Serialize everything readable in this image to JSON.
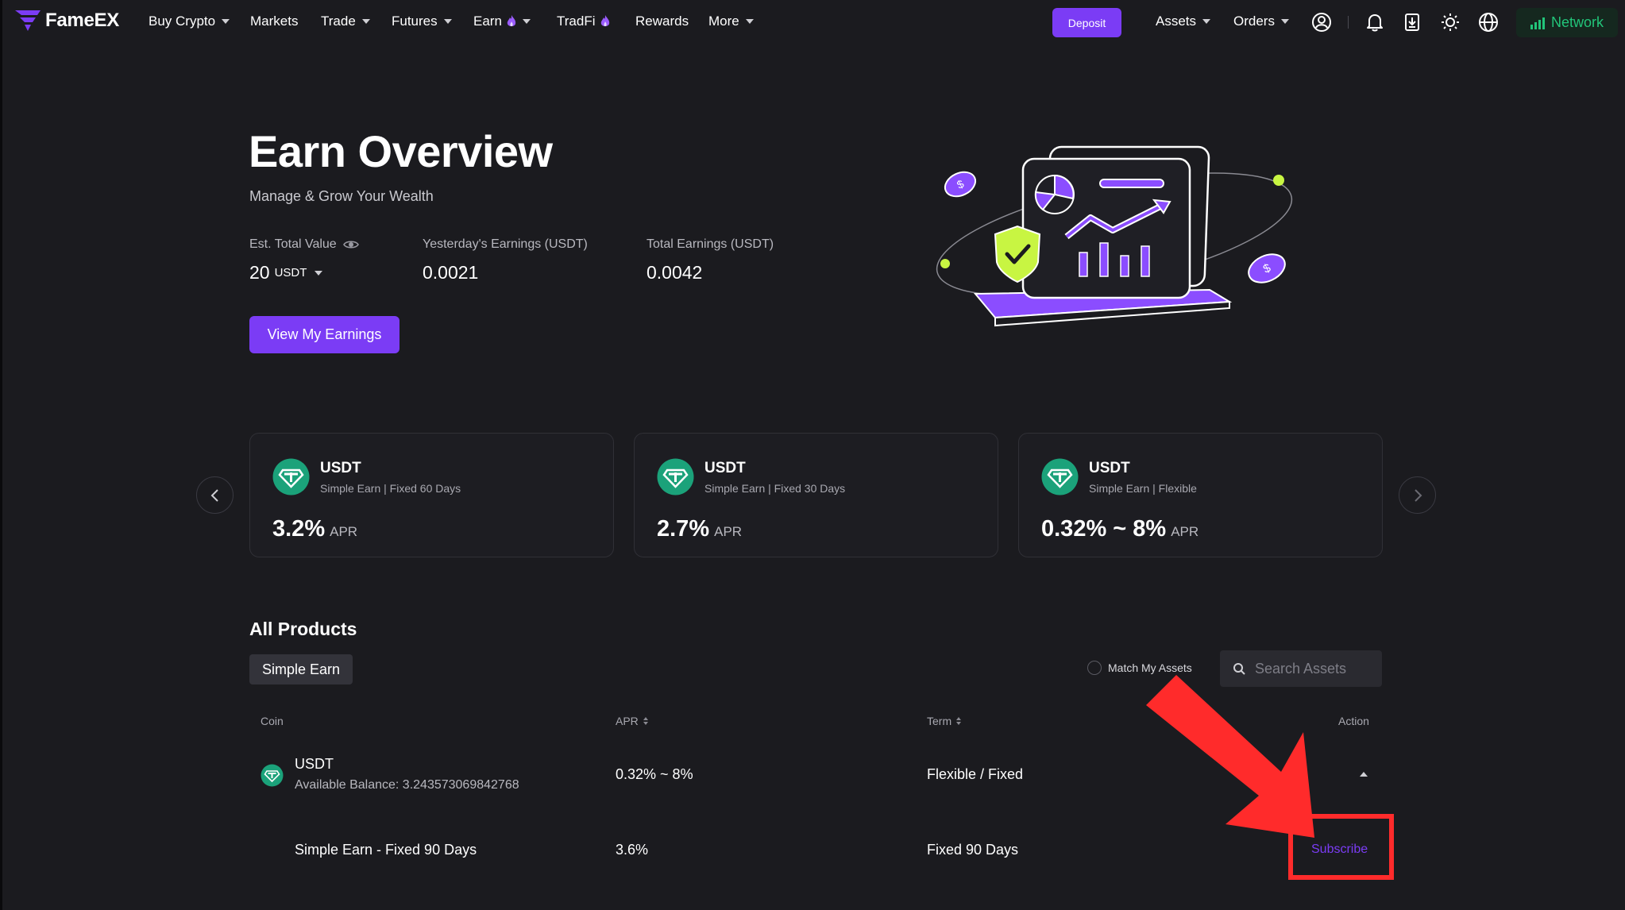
{
  "header": {
    "brand": "FameEX",
    "nav": [
      {
        "label": "Buy Crypto",
        "dropdown": true
      },
      {
        "label": "Markets"
      },
      {
        "label": "Trade",
        "dropdown": true
      },
      {
        "label": "Futures",
        "dropdown": true
      },
      {
        "label": "Earn",
        "dropdown": true,
        "hot": true
      },
      {
        "label": "TradFi",
        "hot": true
      },
      {
        "label": "Rewards"
      },
      {
        "label": "More",
        "dropdown": true
      }
    ],
    "deposit_label": "Deposit",
    "assets_label": "Assets",
    "orders_label": "Orders",
    "icons": [
      "user-icon",
      "bell-icon",
      "download-icon",
      "sun-icon",
      "globe-icon"
    ],
    "network_label": "Network"
  },
  "hero": {
    "title": "Earn Overview",
    "subtitle": "Manage & Grow Your Wealth",
    "est_total_label": "Est. Total Value",
    "est_total_value": "20",
    "est_total_unit": "USDT",
    "yesterday_label": "Yesterday's Earnings (USDT)",
    "yesterday_value": "0.0021",
    "total_label": "Total Earnings (USDT)",
    "total_value": "0.0042",
    "view_button": "View My Earnings"
  },
  "cards": [
    {
      "coin": "USDT",
      "sub": "Simple Earn | Fixed 60 Days",
      "apr": "3.2%",
      "apr_label": "APR"
    },
    {
      "coin": "USDT",
      "sub": "Simple Earn | Fixed 30 Days",
      "apr": "2.7%",
      "apr_label": "APR"
    },
    {
      "coin": "USDT",
      "sub": "Simple Earn | Flexible",
      "apr": "0.32% ~ 8%",
      "apr_label": "APR"
    }
  ],
  "products": {
    "title": "All Products",
    "tab": "Simple Earn",
    "match_label": "Match My Assets",
    "search_placeholder": "Search Assets",
    "columns": {
      "coin": "Coin",
      "apr": "APR",
      "term": "Term",
      "action": "Action"
    },
    "rows": [
      {
        "coin": "USDT",
        "balance": "Available Balance: 3.243573069842768",
        "apr": "0.32% ~ 8%",
        "term": "Flexible / Fixed"
      }
    ],
    "subrows": [
      {
        "name": "Simple Earn - Fixed 90 Days",
        "apr": "3.6%",
        "term": "Fixed 90 Days",
        "action": "Subscribe"
      }
    ]
  },
  "colors": {
    "accent": "#7b3cf5",
    "network": "#22c57a",
    "annotation": "#ff2b2b",
    "usdt": "#1ba27a"
  }
}
